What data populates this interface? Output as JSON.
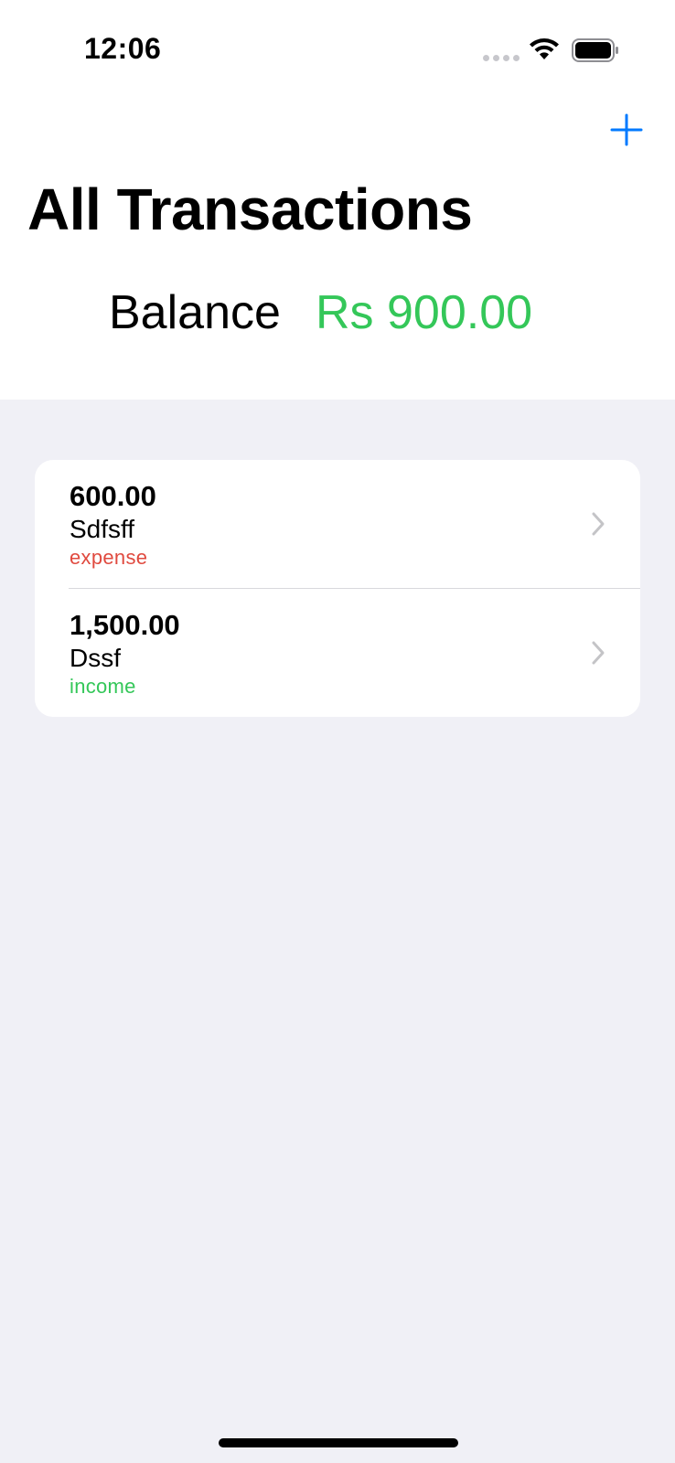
{
  "status_bar": {
    "time": "12:06"
  },
  "nav": {
    "title": "All Transactions",
    "add_icon": "plus-icon",
    "accent_color": "#007aff"
  },
  "balance": {
    "label": "Balance",
    "value": "Rs 900.00",
    "color": "#34c759"
  },
  "transactions": [
    {
      "amount": "600.00",
      "name": "Sdfsff",
      "type": "expense",
      "type_color": "#e04a3f"
    },
    {
      "amount": "1,500.00",
      "name": "Dssf",
      "type": "income",
      "type_color": "#34c759"
    }
  ],
  "icons": {
    "wifi": "wifi-icon",
    "battery": "battery-icon",
    "chevron": "chevron-right-icon"
  }
}
